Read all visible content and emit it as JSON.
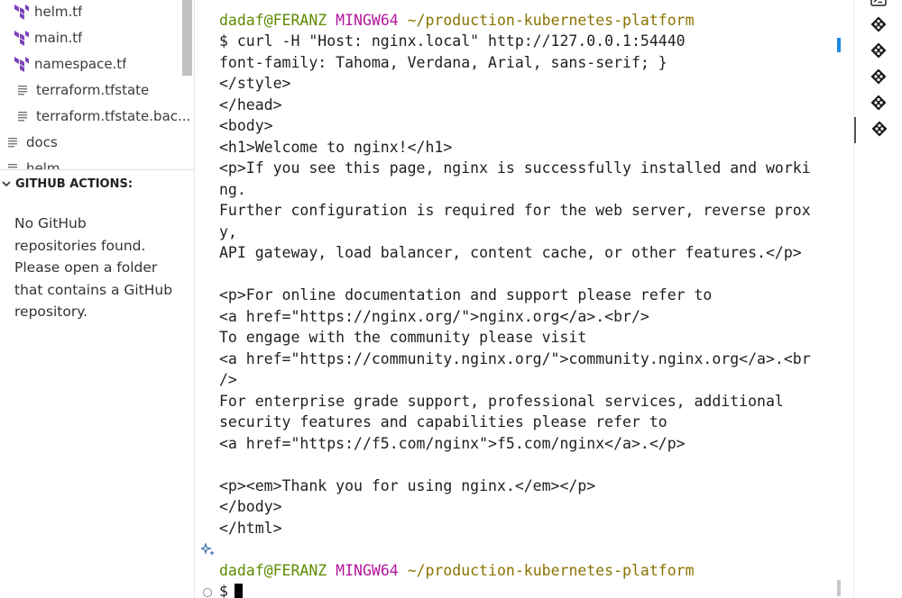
{
  "explorer": {
    "items": [
      {
        "label": "helm.tf",
        "icon": "terraform-icon"
      },
      {
        "label": "main.tf",
        "icon": "terraform-icon"
      },
      {
        "label": "namespace.tf",
        "icon": "terraform-icon"
      },
      {
        "label": "terraform.tfstate",
        "icon": "file-lines-icon"
      },
      {
        "label": "terraform.tfstate.bac...",
        "icon": "file-lines-icon"
      },
      {
        "label": "docs",
        "icon": "file-lines-icon"
      },
      {
        "label": "helm",
        "icon": "file-lines-icon"
      }
    ]
  },
  "github_actions": {
    "title": "GITHUB ACTIONS:",
    "message_lines": [
      "No GitHub",
      "repositories found.",
      "Please open a folder",
      "that contains a GitHub",
      "repository."
    ]
  },
  "terminal": {
    "prompt": {
      "user_host": "dadaf@FERANZ",
      "env": "MINGW64",
      "path": "~/production-kubernetes-platform"
    },
    "command": "$ curl -H \"Host: nginx.local\" http://127.0.0.1:54440",
    "output_lines": [
      "font-family: Tahoma, Verdana, Arial, sans-serif; }",
      "</style>",
      "</head>",
      "<body>",
      "<h1>Welcome to nginx!</h1>",
      "<p>If you see this page, nginx is successfully installed and worki",
      "ng.",
      "Further configuration is required for the web server, reverse prox",
      "y,",
      "API gateway, load balancer, content cache, or other features.</p>",
      "",
      "<p>For online documentation and support please refer to",
      "<a href=\"https://nginx.org/\">nginx.org</a>.<br/>",
      "To engage with the community please visit",
      "<a href=\"https://community.nginx.org/\">community.nginx.org</a>.<br",
      "/>",
      "For enterprise grade support, professional services, additional",
      "security features and capabilities please refer to",
      "<a href=\"https://f5.com/nginx\">f5.com/nginx</a>.</p>",
      "",
      "<p><em>Thank you for using nginx.</em></p>",
      "</body>",
      "</html>"
    ],
    "input_prefix": "$"
  },
  "right_tabs": [
    {
      "icon": "terminal-icon"
    },
    {
      "icon": "git-bash-icon"
    },
    {
      "icon": "git-bash-icon"
    },
    {
      "icon": "git-bash-icon"
    },
    {
      "icon": "git-bash-icon"
    },
    {
      "icon": "git-bash-icon",
      "active": true
    }
  ],
  "colors": {
    "prompt_user": "#5e8b00",
    "prompt_env": "#b5179e",
    "prompt_path": "#8a7300",
    "terraform_purple": "#7b42bc",
    "ruler_accent": "#1e88e5"
  }
}
